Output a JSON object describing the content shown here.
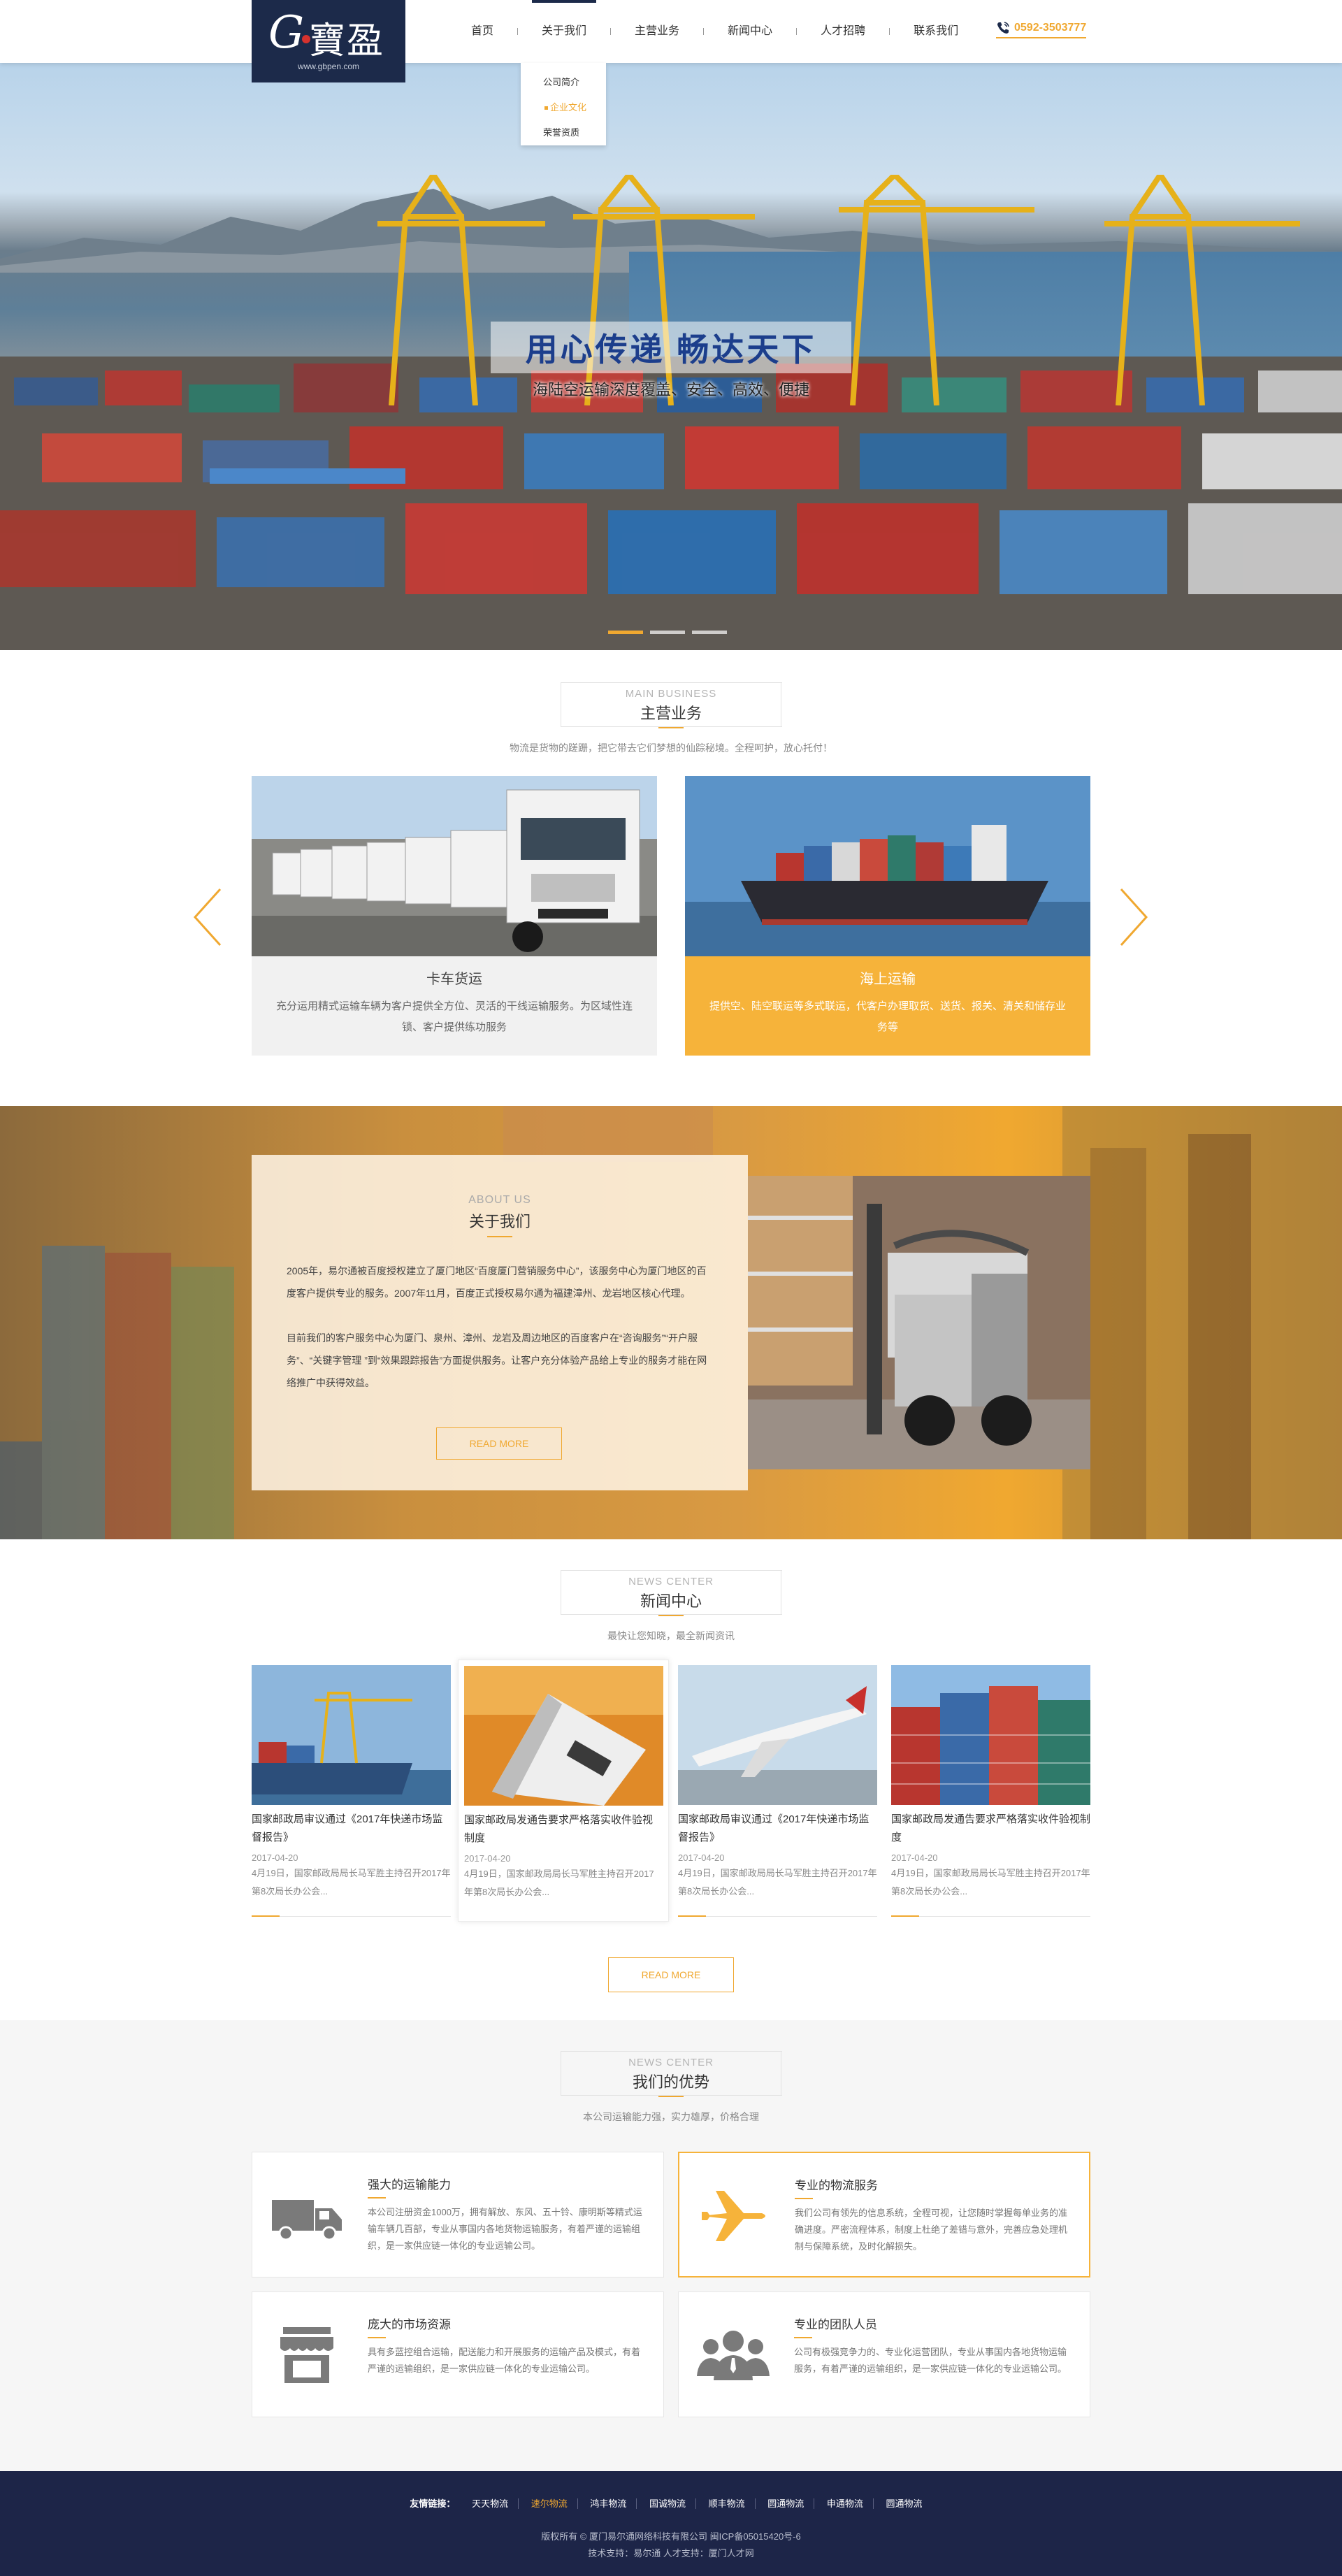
{
  "header": {
    "logo_mark": "G",
    "logo_cn": "寶盈",
    "logo_url": "www.gbpen.com",
    "nav": [
      "首页",
      "关于我们",
      "主营业务",
      "新闻中心",
      "人才招聘",
      "联系我们"
    ],
    "phone": "0592-3503777",
    "dropdown": [
      "公司简介",
      "企业文化",
      "荣誉资质"
    ]
  },
  "banner": {
    "slogan": "用心传递  畅达天下",
    "subline": "海陆空运输深度覆盖、安全、高效、便捷"
  },
  "business": {
    "en": "MAIN BUSINESS",
    "cn": "主营业务",
    "sub": "物流是货物的蹉跚，把它带去它们梦想的仙踪秘境。全程呵护，放心托付！",
    "cards": [
      {
        "title": "卡车货运",
        "desc": "充分运用精式运输车辆为客户提供全方位、灵活的干线运输服务。为区域性连锁、客户提供练功服务"
      },
      {
        "title": "海上运输",
        "desc": "提供空、陆空联运等多式联运，代客户办理取货、送货、报关、清关和储存业务等"
      }
    ]
  },
  "about": {
    "en": "ABOUT US",
    "cn": "关于我们",
    "p1": "2005年，易尔通被百度授权建立了厦门地区“百度厦门营销服务中心”，该服务中心为厦门地区的百度客户提供专业的服务。2007年11月，百度正式授权易尔通为福建漳州、龙岩地区核心代理。",
    "p2": "目前我们的客户服务中心为厦门、泉州、漳州、龙岩及周边地区的百度客户在“咨询服务”“开户服务”、“关键字管理 ”到“效果跟踪报告”方面提供服务。让客户充分体验产品给上专业的服务才能在网络推广中获得效益。",
    "more": "READ MORE"
  },
  "news": {
    "en": "NEWS CENTER",
    "cn": "新闻中心",
    "sub": "最快让您知晓，最全新闻资讯",
    "items": [
      {
        "title": "国家邮政局审议通过《2017年快递市场监督报告》",
        "date": "2017-04-20",
        "summary": "4月19日，国家邮政局局长马军胜主持召开2017年第8次局长办公会..."
      },
      {
        "title": "国家邮政局发通告要求严格落实收件验视制度",
        "date": "2017-04-20",
        "summary": "4月19日，国家邮政局局长马军胜主持召开2017年第8次局长办公会..."
      },
      {
        "title": "国家邮政局审议通过《2017年快递市场监督报告》",
        "date": "2017-04-20",
        "summary": "4月19日，国家邮政局局长马军胜主持召开2017年第8次局长办公会..."
      },
      {
        "title": "国家邮政局发通告要求严格落实收件验视制度",
        "date": "2017-04-20",
        "summary": "4月19日，国家邮政局局长马军胜主持召开2017年第8次局长办公会..."
      }
    ],
    "more": "READ MORE"
  },
  "advantage": {
    "en": "NEWS CENTER",
    "cn": "我们的优势",
    "sub": "本公司运输能力强，实力雄厚，价格合理",
    "items": [
      {
        "title": "强大的运输能力",
        "desc": "本公司注册资金1000万，拥有解放、东风、五十铃、康明斯等精式运输车辆几百部，专业从事国内各地货物运输服务，有着严谨的运输组织，是一家供应链一体化的专业运输公司。",
        "icon": "truck-icon"
      },
      {
        "title": "专业的物流服务",
        "desc": "我们公司有领先的信息系统，全程可视，让您随时掌握每单业务的准确进度。严密流程体系，制度上杜绝了差错与意外，完善应急处理机制与保障系统，及时化解损失。",
        "icon": "airplane-icon"
      },
      {
        "title": "庞大的市场资源",
        "desc": "具有多蓝控组合运输，配送能力和开展服务的运输产品及模式，有着严谨的运输组织，是一家供应链一体化的专业运输公司。",
        "icon": "store-icon"
      },
      {
        "title": "专业的团队人员",
        "desc": "公司有极强竞争力的、专业化运营团队，专业从事国内各地货物运输服务，有着严谨的运输组织，是一家供应链一体化的专业运输公司。",
        "icon": "team-icon"
      }
    ]
  },
  "footer": {
    "links_label": "友情链接：",
    "links": [
      "天天物流",
      "速尔物流",
      "鸿丰物流",
      "国诚物流",
      "顺丰物流",
      "圆通物流",
      "申通物流",
      "圆通物流"
    ],
    "copyright": "版权所有 © 厦门易尔通网络科技有限公司 闽ICP备05015420号-6",
    "tech": "技术支持：易尔通   人才支持：厦门人才网"
  },
  "colors": {
    "accent": "#f0a830",
    "navy": "#1c2a4a",
    "footer": "#1d2548"
  }
}
